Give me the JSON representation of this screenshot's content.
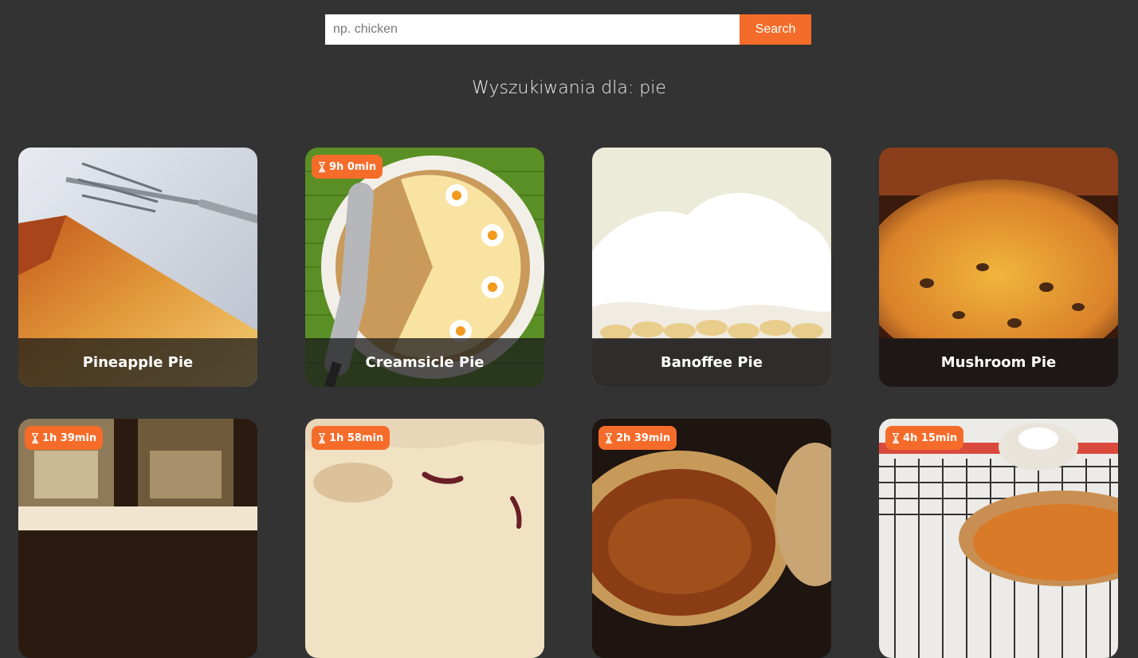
{
  "search": {
    "placeholder": "np. chicken",
    "button_label": "Search"
  },
  "results": {
    "heading": "Wyszukiwania dla: pie"
  },
  "colors": {
    "accent": "#f56c2a",
    "background": "#333333"
  },
  "recipes": [
    {
      "title": "Pineapple Pie",
      "time": "",
      "image": "pineapple-pie-photo"
    },
    {
      "title": "Creamsicle Pie",
      "time": "9h 0min",
      "image": "creamsicle-pie-photo"
    },
    {
      "title": "Banoffee Pie",
      "time": "",
      "image": "banoffee-pie-photo"
    },
    {
      "title": "Mushroom Pie",
      "time": "",
      "image": "mushroom-pie-photo"
    },
    {
      "title": "",
      "time": "1h 39min",
      "image": "pie-photo"
    },
    {
      "title": "",
      "time": "1h 58min",
      "image": "pie-photo"
    },
    {
      "title": "",
      "time": "2h 39min",
      "image": "pie-photo"
    },
    {
      "title": "",
      "time": "4h 15min",
      "image": "pie-photo"
    }
  ]
}
